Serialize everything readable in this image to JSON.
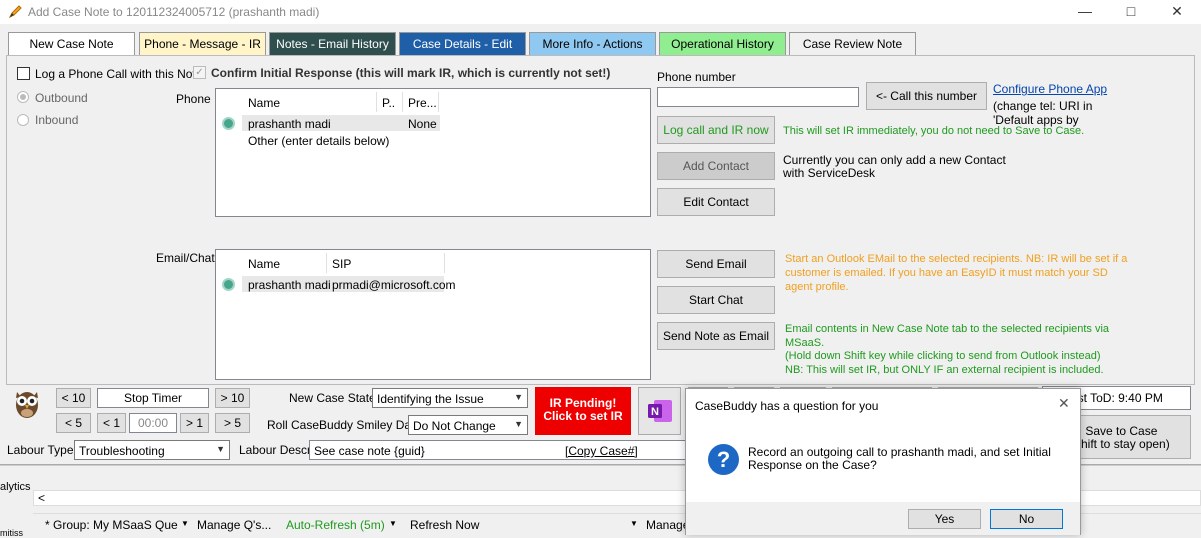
{
  "window": {
    "title": "Add Case Note to 120112324005712 (prashanth madi)"
  },
  "tabs": [
    {
      "label": "New Case Note",
      "bg": "#ffffff",
      "fg": "#000000"
    },
    {
      "label": "Phone - Message - IR",
      "bg": "#fff5c8",
      "fg": "#000000"
    },
    {
      "label": "Notes - Email History",
      "bg": "#2f4f4f",
      "fg": "#ffffff"
    },
    {
      "label": "Case Details - Edit",
      "bg": "#1f5fa8",
      "fg": "#ffffff"
    },
    {
      "label": "More Info - Actions",
      "bg": "#8fc8f0",
      "fg": "#000000"
    },
    {
      "label": "Operational History",
      "bg": "#90ee90",
      "fg": "#000000"
    },
    {
      "label": "Case Review Note",
      "bg": "#f0f0f0",
      "fg": "#000000"
    }
  ],
  "phone_section": {
    "log_call_label": "Log a Phone Call with this Note",
    "confirm_ir_label": "Confirm Initial Response (this will mark IR, which is currently not set!)",
    "outbound_label": "Outbound",
    "inbound_label": "Inbound",
    "phone_label": "Phone",
    "phone_columns": [
      "Name",
      "P..",
      "Pre..."
    ],
    "phone_rows": [
      [
        "prashanth madi",
        "",
        "None"
      ]
    ],
    "phone_other": "Other (enter details below)",
    "phone_number_label": "Phone number",
    "call_button": "<- Call this number",
    "configure_link": "Configure Phone App",
    "configure_note": "(change tel: URI in\n'Default apps by",
    "log_ir_button": "Log call and IR now",
    "log_ir_note": "This will set IR immediately, you do not need to Save to Case.",
    "add_contact_button": "Add Contact",
    "add_contact_note": "Currently you can only add a new Contact\nwith ServiceDesk",
    "edit_contact_button": "Edit Contact"
  },
  "email_section": {
    "label": "Email/Chat",
    "columns": [
      "Name",
      "SIP"
    ],
    "rows": [
      [
        "prashanth madi",
        "prmadi@microsoft.com"
      ]
    ],
    "send_email_button": "Send Email",
    "send_email_note": "Start an Outlook EMail to the selected recipients.  NB: IR will be set if a customer is emailed. If you have an EasyID it must match your SD agent profile.",
    "start_chat_button": "Start Chat",
    "send_note_button": "Send Note as Email",
    "send_note_text": "Email contents in New Case Note tab to the selected recipients via MSaaS.\n(Hold down Shift key while clicking to send from Outlook instead)\nNB: This will set IR, but ONLY IF an external recipient is included."
  },
  "bottom": {
    "lt10": "< 10",
    "stop_timer": "Stop Timer",
    "gt10": "> 10",
    "lt5": "< 5",
    "lt1": "< 1",
    "time": "00:00",
    "gt1": "> 1",
    "gt5": "> 5",
    "new_case_state_label": "New Case State",
    "new_case_state_value": "Identifying the Issue",
    "roll_smiley_label": "Roll CaseBuddy Smiley Date",
    "roll_smiley_value": "Do Not Change",
    "ir_pending": "IR Pending!\nClick to set IR",
    "labour_type_label": "Labour Type",
    "labour_type_value": "Troubleshooting",
    "labour_descr_label": "Labour Descr",
    "labour_descr_value": "See case note {guid}",
    "copy_case": "[Copy Case#]",
    "tod": "ust ToD: 9:40 PM",
    "save_to_case": "Save to Case\nShift to stay open)"
  },
  "dialog": {
    "title": "CaseBuddy has a question for you",
    "message": "Record an outgoing call to prashanth madi, and set Initial Response on the Case?",
    "yes": "Yes",
    "no": "No"
  },
  "background": {
    "analytics_fragment": "alytics",
    "scroll_left": "<",
    "group_item": "* Group: My MSaaS Que",
    "manage_qs": "Manage Q's...",
    "auto_refresh": "Auto-Refresh (5m)",
    "refresh_now": "Refresh Now",
    "manage_right": "Manage",
    "bottom_fragment": "mitiss"
  }
}
